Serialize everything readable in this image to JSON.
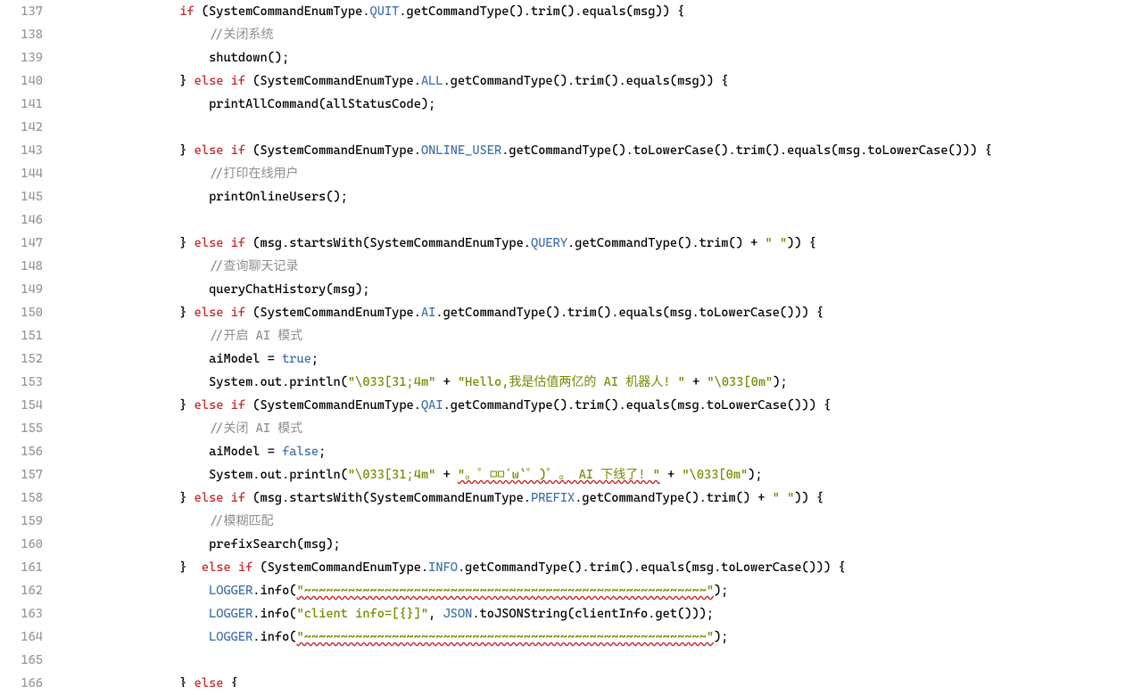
{
  "startLine": 137,
  "lines": [
    {
      "n": 137,
      "tokens": [
        {
          "t": "                ",
          "c": ""
        },
        {
          "t": "if",
          "c": "kw"
        },
        {
          "t": " (SystemCommandEnumType.",
          "c": ""
        },
        {
          "t": "QUIT",
          "c": "const"
        },
        {
          "t": ".getCommandType().trim().equals(msg)) {",
          "c": ""
        }
      ]
    },
    {
      "n": 138,
      "tokens": [
        {
          "t": "                    ",
          "c": ""
        },
        {
          "t": "//关闭系统",
          "c": "comment"
        }
      ]
    },
    {
      "n": 139,
      "tokens": [
        {
          "t": "                    shutdown();",
          "c": ""
        }
      ]
    },
    {
      "n": 140,
      "tokens": [
        {
          "t": "                } ",
          "c": ""
        },
        {
          "t": "else if",
          "c": "kw"
        },
        {
          "t": " (SystemCommandEnumType.",
          "c": ""
        },
        {
          "t": "ALL",
          "c": "const"
        },
        {
          "t": ".getCommandType().trim().equals(msg)) {",
          "c": ""
        }
      ]
    },
    {
      "n": 141,
      "tokens": [
        {
          "t": "                    printAllCommand(allStatusCode);",
          "c": ""
        }
      ]
    },
    {
      "n": 142,
      "tokens": [
        {
          "t": "",
          "c": ""
        }
      ]
    },
    {
      "n": 143,
      "tokens": [
        {
          "t": "                } ",
          "c": ""
        },
        {
          "t": "else if",
          "c": "kw"
        },
        {
          "t": " (SystemCommandEnumType.",
          "c": ""
        },
        {
          "t": "ONLINE_USER",
          "c": "const"
        },
        {
          "t": ".getCommandType().toLowerCase().trim().equals(msg.toLowerCase())) {",
          "c": ""
        }
      ]
    },
    {
      "n": 144,
      "tokens": [
        {
          "t": "                    ",
          "c": ""
        },
        {
          "t": "//打印在线用户",
          "c": "comment"
        }
      ]
    },
    {
      "n": 145,
      "tokens": [
        {
          "t": "                    printOnlineUsers();",
          "c": ""
        }
      ]
    },
    {
      "n": 146,
      "tokens": [
        {
          "t": "",
          "c": ""
        }
      ]
    },
    {
      "n": 147,
      "tokens": [
        {
          "t": "                } ",
          "c": ""
        },
        {
          "t": "else if",
          "c": "kw"
        },
        {
          "t": " (msg.startsWith(SystemCommandEnumType.",
          "c": ""
        },
        {
          "t": "QUERY",
          "c": "const"
        },
        {
          "t": ".getCommandType().trim() + ",
          "c": ""
        },
        {
          "t": "\" \"",
          "c": "str"
        },
        {
          "t": ")) {",
          "c": ""
        }
      ]
    },
    {
      "n": 148,
      "tokens": [
        {
          "t": "                    ",
          "c": ""
        },
        {
          "t": "//查询聊天记录",
          "c": "comment"
        }
      ]
    },
    {
      "n": 149,
      "tokens": [
        {
          "t": "                    queryChatHistory(msg);",
          "c": ""
        }
      ]
    },
    {
      "n": 150,
      "tokens": [
        {
          "t": "                } ",
          "c": ""
        },
        {
          "t": "else if",
          "c": "kw"
        },
        {
          "t": " (SystemCommandEnumType.",
          "c": ""
        },
        {
          "t": "AI",
          "c": "const"
        },
        {
          "t": ".getCommandType().trim().equals(msg.toLowerCase())) {",
          "c": ""
        }
      ]
    },
    {
      "n": 151,
      "tokens": [
        {
          "t": "                    ",
          "c": ""
        },
        {
          "t": "//开启 AI 模式",
          "c": "comment"
        }
      ]
    },
    {
      "n": 152,
      "tokens": [
        {
          "t": "                    aiModel = ",
          "c": ""
        },
        {
          "t": "true",
          "c": "bool"
        },
        {
          "t": ";",
          "c": ""
        }
      ]
    },
    {
      "n": 153,
      "tokens": [
        {
          "t": "                    System.out.println(",
          "c": ""
        },
        {
          "t": "\"\\033[31;4m\"",
          "c": "str"
        },
        {
          "t": " + ",
          "c": ""
        },
        {
          "t": "\"Hello,我是估值两亿的 AI 机器人! \"",
          "c": "str"
        },
        {
          "t": " + ",
          "c": ""
        },
        {
          "t": "\"\\033[0m\"",
          "c": "str"
        },
        {
          "t": ");",
          "c": ""
        }
      ]
    },
    {
      "n": 154,
      "tokens": [
        {
          "t": "                } ",
          "c": ""
        },
        {
          "t": "else if",
          "c": "kw"
        },
        {
          "t": " (SystemCommandEnumType.",
          "c": ""
        },
        {
          "t": "QAI",
          "c": "const"
        },
        {
          "t": ".getCommandType().trim().equals(msg.toLowerCase())) {",
          "c": ""
        }
      ]
    },
    {
      "n": 155,
      "tokens": [
        {
          "t": "                    ",
          "c": ""
        },
        {
          "t": "//关闭 AI 模式",
          "c": "comment"
        }
      ]
    },
    {
      "n": 156,
      "tokens": [
        {
          "t": "                    aiModel = ",
          "c": ""
        },
        {
          "t": "false",
          "c": "bool"
        },
        {
          "t": ";",
          "c": ""
        }
      ]
    },
    {
      "n": 157,
      "tokens": [
        {
          "t": "                    System.out.println(",
          "c": ""
        },
        {
          "t": "\"\\033[31;4m\"",
          "c": "str"
        },
        {
          "t": " + ",
          "c": ""
        },
        {
          "t": "\"。゜□□´ω`゜)゜。 AI 下线了! \"",
          "c": "str err-underline"
        },
        {
          "t": " + ",
          "c": ""
        },
        {
          "t": "\"\\033[0m\"",
          "c": "str"
        },
        {
          "t": ");",
          "c": ""
        }
      ]
    },
    {
      "n": 158,
      "tokens": [
        {
          "t": "                } ",
          "c": ""
        },
        {
          "t": "else if",
          "c": "kw"
        },
        {
          "t": " (msg.startsWith(SystemCommandEnumType.",
          "c": ""
        },
        {
          "t": "PREFIX",
          "c": "const"
        },
        {
          "t": ".getCommandType().trim() + ",
          "c": ""
        },
        {
          "t": "\" \"",
          "c": "str"
        },
        {
          "t": ")) {",
          "c": ""
        }
      ]
    },
    {
      "n": 159,
      "tokens": [
        {
          "t": "                    ",
          "c": ""
        },
        {
          "t": "//模糊匹配",
          "c": "comment"
        }
      ]
    },
    {
      "n": 160,
      "tokens": [
        {
          "t": "                    prefixSearch(msg);",
          "c": ""
        }
      ]
    },
    {
      "n": 161,
      "tokens": [
        {
          "t": "                }  ",
          "c": ""
        },
        {
          "t": "else if",
          "c": "kw"
        },
        {
          "t": " (SystemCommandEnumType.",
          "c": ""
        },
        {
          "t": "INFO",
          "c": "const"
        },
        {
          "t": ".getCommandType().trim().equals(msg.toLowerCase())) {",
          "c": ""
        }
      ]
    },
    {
      "n": 162,
      "tokens": [
        {
          "t": "                    ",
          "c": ""
        },
        {
          "t": "LOGGER",
          "c": "const"
        },
        {
          "t": ".info(",
          "c": ""
        },
        {
          "t": "\"~~~~~~~~~~~~~~~~~~~~~~~~~~~~~~~~~~~~~~~~~~~~~~~~~~~~~~~\"",
          "c": "str err-underline"
        },
        {
          "t": ");",
          "c": ""
        }
      ]
    },
    {
      "n": 163,
      "tokens": [
        {
          "t": "                    ",
          "c": ""
        },
        {
          "t": "LOGGER",
          "c": "const"
        },
        {
          "t": ".info(",
          "c": ""
        },
        {
          "t": "\"client info=[{}]\"",
          "c": "str"
        },
        {
          "t": ", ",
          "c": ""
        },
        {
          "t": "JSON",
          "c": "const"
        },
        {
          "t": ".toJSONString(clientInfo.get()));",
          "c": ""
        }
      ]
    },
    {
      "n": 164,
      "tokens": [
        {
          "t": "                    ",
          "c": ""
        },
        {
          "t": "LOGGER",
          "c": "const"
        },
        {
          "t": ".info(",
          "c": ""
        },
        {
          "t": "\"~~~~~~~~~~~~~~~~~~~~~~~~~~~~~~~~~~~~~~~~~~~~~~~~~~~~~~~\"",
          "c": "str err-underline"
        },
        {
          "t": ");",
          "c": ""
        }
      ]
    },
    {
      "n": 165,
      "tokens": [
        {
          "t": "",
          "c": ""
        }
      ]
    },
    {
      "n": 166,
      "tokens": [
        {
          "t": "                } ",
          "c": ""
        },
        {
          "t": "else",
          "c": "kw"
        },
        {
          "t": " {",
          "c": ""
        }
      ]
    }
  ]
}
